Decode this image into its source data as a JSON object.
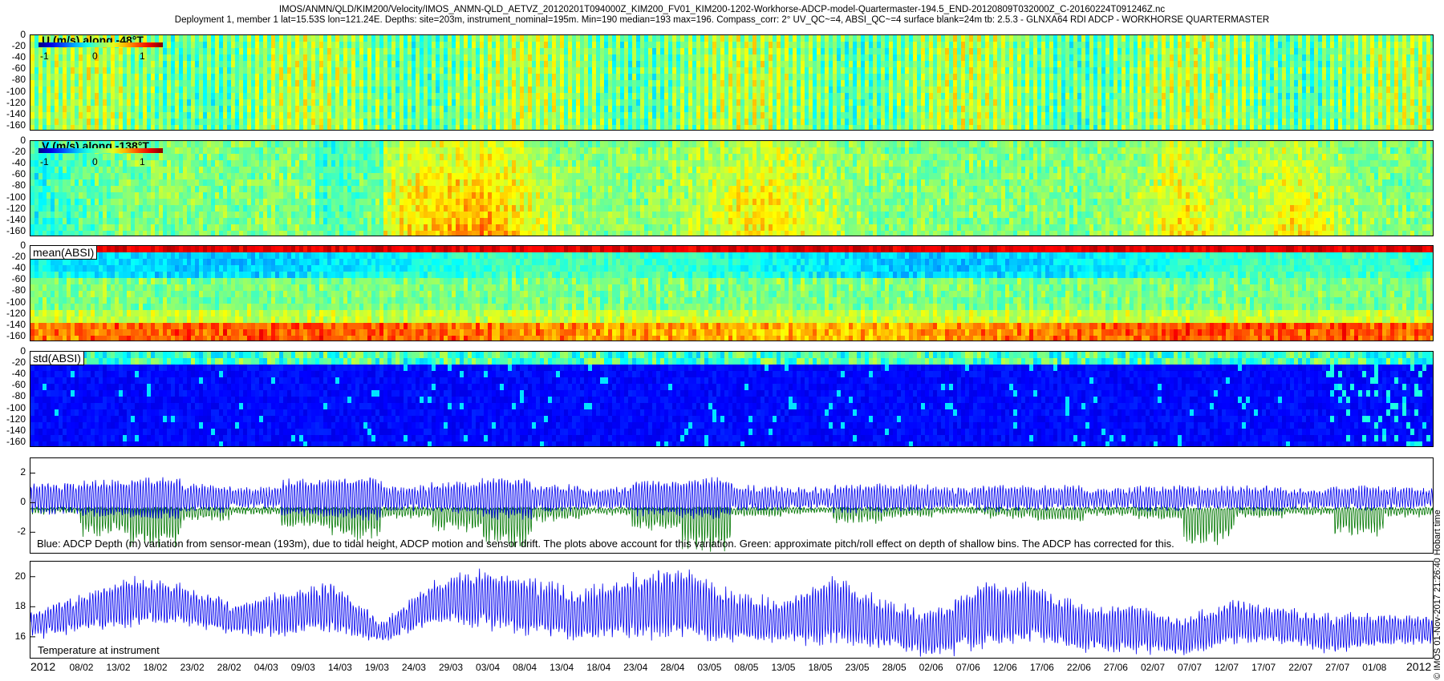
{
  "header": {
    "line1": "IMOS/ANMN/QLD/KIM200/Velocity/IMOS_ANMN-QLD_AETVZ_20120201T094000Z_KIM200_FV01_KIM200-1202-Workhorse-ADCP-model-Quartermaster-194.5_END-20120809T032000Z_C-20160224T091246Z.nc",
    "line2": "Deployment 1, member 1 lat=15.53S lon=121.24E. Depths: site=203m, instrument_nominal=195m. Min=190 median=193 max=196. Compass_corr: 2° UV_QC~=4, ABSI_QC~=4 surface blank=24m tb: 2.5.3 - GLNXA64 RDI ADCP - WORKHORSE QUARTERMASTER"
  },
  "side_note": "© IMOS 01-Nov-2017 21:26:40 Hobart time",
  "colors": {
    "blue_line": "#0000ee",
    "green_line": "#007700",
    "axis": "#000000"
  },
  "chart_data": [
    {
      "type": "heatmap",
      "title": "U (m/s) along -48°T",
      "yticks": [
        "0",
        "-20",
        "-40",
        "-60",
        "-80",
        "-100",
        "-120",
        "-140",
        "-160"
      ],
      "ylim": [
        -170,
        0
      ],
      "colorbar": {
        "ticks": [
          "-1",
          "0",
          "1"
        ],
        "range": [
          -1.3,
          1.3
        ],
        "colormap": "jet"
      },
      "value_range": [
        -0.5,
        0.5
      ],
      "dominant_color": "green"
    },
    {
      "type": "heatmap",
      "title": "V (m/s) along -138°T",
      "yticks": [
        "0",
        "-20",
        "-40",
        "-60",
        "-80",
        "-100",
        "-120",
        "-140",
        "-160"
      ],
      "ylim": [
        -170,
        0
      ],
      "colorbar": {
        "ticks": [
          "-1",
          "0",
          "1"
        ],
        "range": [
          -1.3,
          1.3
        ],
        "colormap": "jet"
      },
      "value_range": [
        -0.4,
        0.5
      ],
      "dominant_color": "green-yellow"
    },
    {
      "type": "heatmap",
      "title": "mean(ABSI)",
      "yticks": [
        "0",
        "-20",
        "-40",
        "-60",
        "-80",
        "-100",
        "-120",
        "-140",
        "-160"
      ],
      "ylim": [
        -170,
        0
      ],
      "colormap": "jet",
      "description_values": {
        "surface": "red",
        "mid": "cyan-green",
        "bottom": "yellow-orange"
      }
    },
    {
      "type": "heatmap",
      "title": "std(ABSI)",
      "yticks": [
        "0",
        "-20",
        "-40",
        "-60",
        "-80",
        "-100",
        "-120",
        "-140",
        "-160"
      ],
      "ylim": [
        -170,
        0
      ],
      "colormap": "jet",
      "description_values": {
        "surface": "cyan",
        "body": "dark-blue"
      }
    },
    {
      "type": "line",
      "yticks": [
        "2",
        "0",
        "-2"
      ],
      "ylim": [
        -3.5,
        3
      ],
      "caption": "Blue: ADCP Depth (m) variation from sensor-mean (193m), due to tidal height, ADCP motion and sensor drift. The plots above account for this variation. Green: approximate pitch/roll effect on depth of shallow bins. The ADCP has corrected for this.",
      "series": [
        {
          "color": "#0000ee",
          "baseline": 0.3,
          "amplitude_by_week": [
            1.6,
            1.9,
            2.2,
            1.4,
            1.0,
            2.0,
            2.3,
            1.2,
            1.6,
            2.2,
            1.3,
            1.0,
            1.8,
            2.2,
            1.2,
            1.0,
            1.5,
            1.3,
            1.0,
            1.3,
            1.2,
            1.0,
            1.3,
            1.1,
            1.2,
            1.0,
            1.2,
            1.0
          ]
        },
        {
          "color": "#007700",
          "baseline": -0.4,
          "dips_by_week": [
            0.3,
            1.8,
            2.8,
            0.8,
            0.4,
            1.2,
            2.0,
            0.6,
            1.5,
            2.5,
            0.8,
            0.4,
            1.5,
            2.8,
            0.5,
            0.3,
            0.9,
            0.6,
            0.3,
            0.6,
            0.8,
            0.4,
            0.7,
            2.5,
            0.6,
            0.4,
            1.8,
            0.5
          ]
        }
      ]
    },
    {
      "type": "line",
      "yticks": [
        "20",
        "18",
        "16"
      ],
      "ylim": [
        14.5,
        21
      ],
      "caption": "Temperature at instrument",
      "series": [
        {
          "color": "#0000ee",
          "mean_by_week": [
            16.8,
            17.6,
            18.4,
            18.2,
            17.2,
            17.5,
            18.0,
            16.3,
            18.2,
            18.6,
            18.0,
            17.4,
            18.0,
            18.3,
            17.2,
            17.0,
            17.8,
            16.8,
            16.2,
            17.5,
            17.6,
            16.5,
            16.6,
            16.0,
            17.0,
            16.7,
            16.2,
            16.5,
            16.4
          ],
          "amp_by_week": [
            0.8,
            1.2,
            1.6,
            1.3,
            1.0,
            1.4,
            1.6,
            0.6,
            1.4,
            1.8,
            1.8,
            1.6,
            2.0,
            2.4,
            1.6,
            1.4,
            2.2,
            1.6,
            1.4,
            2.2,
            1.8,
            1.4,
            1.6,
            1.2,
            1.4,
            1.2,
            1.2,
            1.0,
            0.9
          ]
        }
      ]
    }
  ],
  "xaxis": {
    "year_left": "2012",
    "year_right": "2012",
    "ticks": [
      "08/02",
      "13/02",
      "18/02",
      "23/02",
      "28/02",
      "04/03",
      "09/03",
      "14/03",
      "19/03",
      "24/03",
      "29/03",
      "03/04",
      "08/04",
      "13/04",
      "18/04",
      "23/04",
      "28/04",
      "03/05",
      "08/05",
      "13/05",
      "18/05",
      "23/05",
      "28/05",
      "02/06",
      "07/06",
      "12/06",
      "17/06",
      "22/06",
      "27/06",
      "02/07",
      "07/07",
      "12/07",
      "17/07",
      "22/07",
      "27/07",
      "01/08"
    ]
  }
}
